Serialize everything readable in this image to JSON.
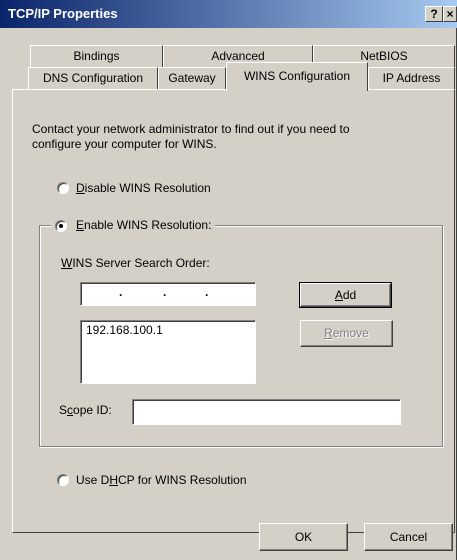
{
  "window": {
    "title": "TCP/IP Properties",
    "help_label": "?",
    "close_label": "×"
  },
  "tabs": {
    "row1": [
      "Bindings",
      "Advanced",
      "NetBIOS"
    ],
    "row2": [
      "DNS Configuration",
      "Gateway",
      "WINS Configuration",
      "IP Address"
    ],
    "active": "WINS Configuration"
  },
  "panel": {
    "info_line1": "Contact your network administrator to find out if you need to",
    "info_line2": "configure your computer for WINS.",
    "disable_wins": {
      "mnemonic": "D",
      "rest": "isable WINS Resolution",
      "selected": false
    },
    "enable_wins": {
      "mnemonic": "E",
      "rest": "nable WINS Resolution:",
      "selected": true
    },
    "server_order_label": {
      "mnemonic": "W",
      "rest": "INS Server Search Order:"
    },
    "ip_input_dots": ". . .",
    "add_button": {
      "mnemonic": "A",
      "rest": "dd"
    },
    "remove_button": {
      "mnemonic": "R",
      "rest": "emove"
    },
    "server_list": [
      "192.168.100.1"
    ],
    "scope_id": {
      "pre": "S",
      "mnemonic": "c",
      "rest": "ope ID:",
      "value": ""
    },
    "use_dhcp": {
      "pre": "Use D",
      "mnemonic": "H",
      "rest": "CP for WINS Resolution",
      "selected": false
    }
  },
  "footer": {
    "ok_label": "OK",
    "cancel_label": "Cancel"
  }
}
